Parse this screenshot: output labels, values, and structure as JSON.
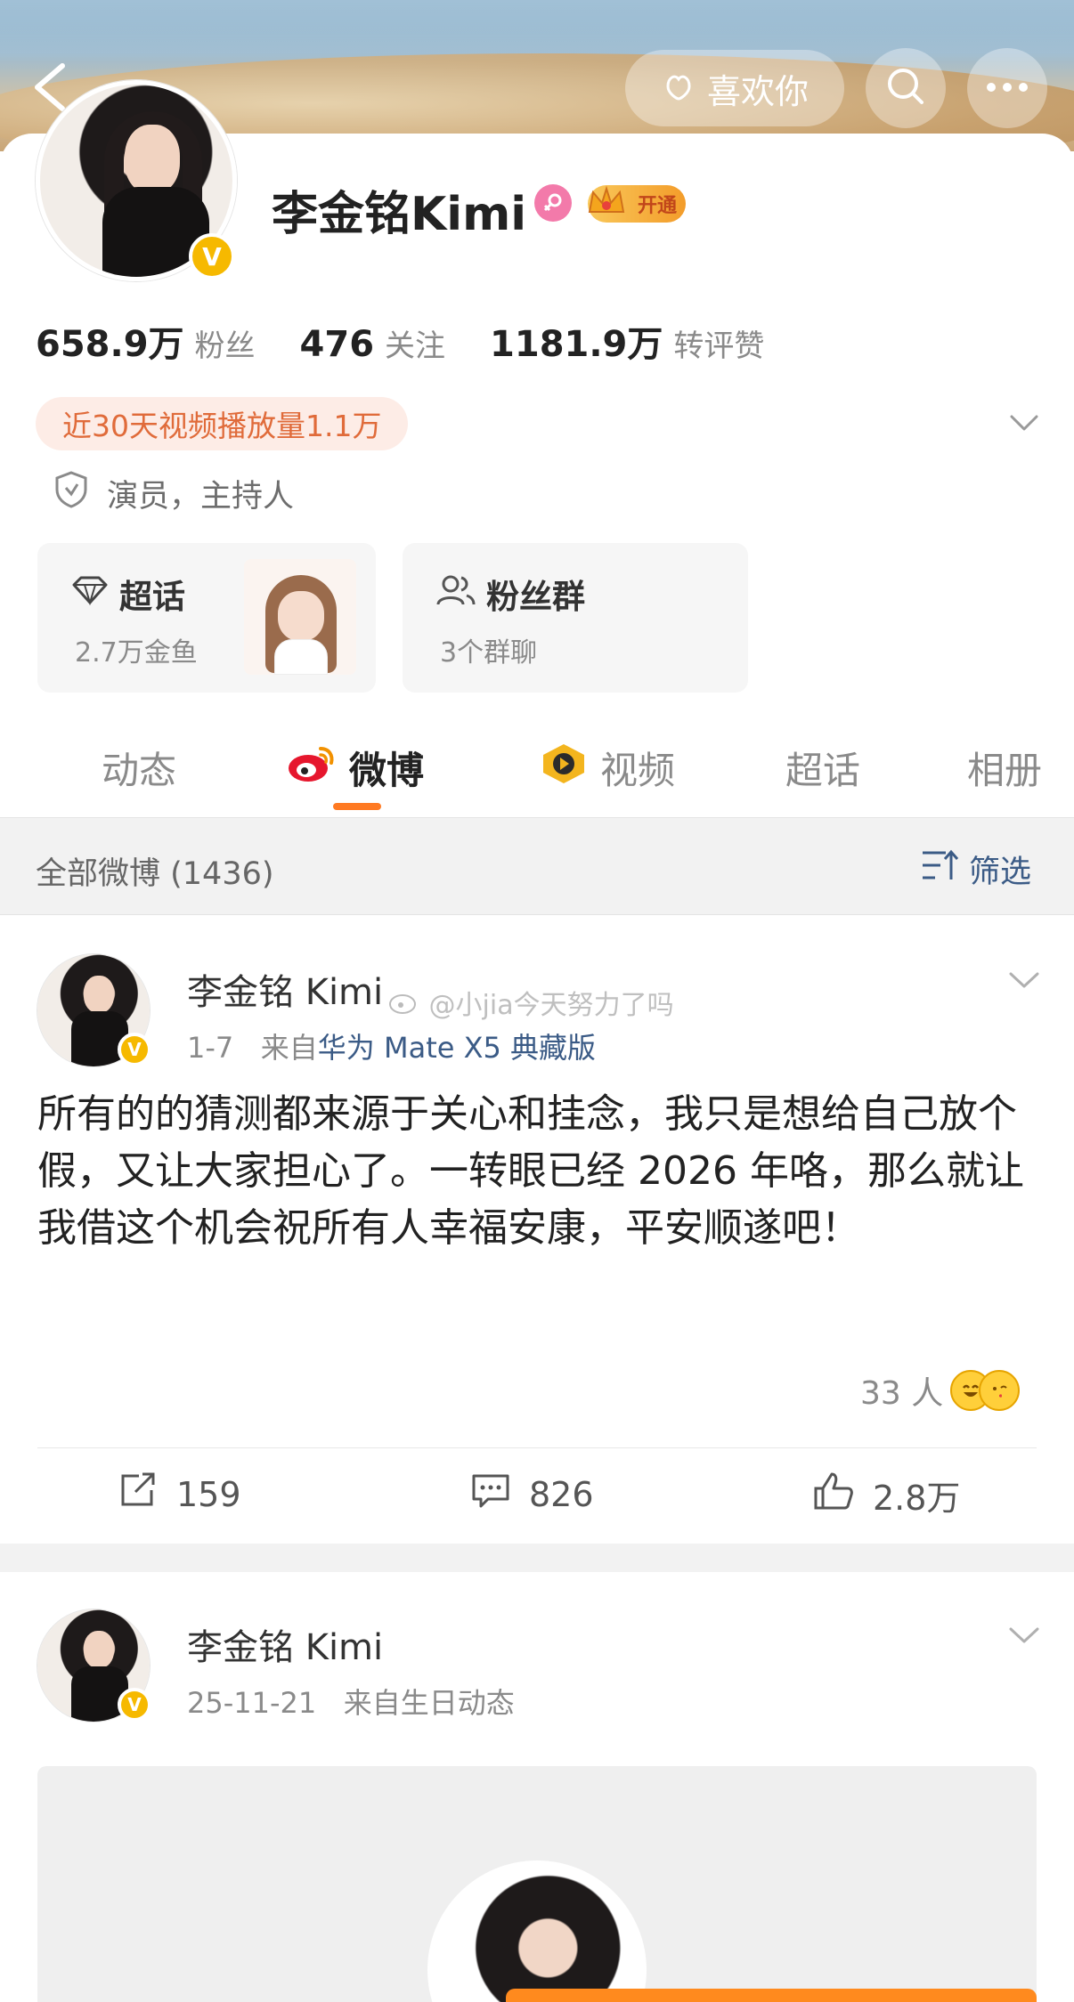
{
  "header": {
    "like_button_label": "喜欢你"
  },
  "profile": {
    "name": "李金铭Kimi",
    "vip_badge_label": "开通",
    "stats": [
      {
        "value": "658.9万",
        "label": "粉丝"
      },
      {
        "value": "476",
        "label": "关注"
      },
      {
        "value": "1181.9万",
        "label": "转评赞"
      }
    ],
    "video_plays": "近30天视频播放量1.1万",
    "tags": "演员，主持人",
    "cards": [
      {
        "title": "超话",
        "sub": "2.7万金鱼"
      },
      {
        "title": "粉丝群",
        "sub": "3个群聊"
      }
    ]
  },
  "tabs": [
    {
      "label": "动态"
    },
    {
      "label": "微博"
    },
    {
      "label": "视频"
    },
    {
      "label": "超话"
    },
    {
      "label": "相册"
    }
  ],
  "filter": {
    "label": "全部微博 (1436)",
    "button": "筛选"
  },
  "posts": [
    {
      "author": "李金铭 Kimi",
      "date": "1-7",
      "source_prefix": "来自",
      "device": "华为 Mate X5 典藏版",
      "text": "所有的的猜测都来源于关心和挂念，我只是想给自己放个假，又让大家担心了。一转眼已经 2026 年咯，那么就让我借这个机会祝所有人幸福安康，平安顺遂吧！",
      "watermark": "@小jia今天努力了吗",
      "reactions": "33 人",
      "reposts": "159",
      "comments": "826",
      "likes": "2.8万"
    },
    {
      "author": "李金铭 Kimi",
      "date": "25-11-21",
      "source": "来自生日动态"
    }
  ],
  "colors": {
    "accent": "#ff7a22",
    "link": "#3b5b86",
    "verified": "#f6b900"
  }
}
